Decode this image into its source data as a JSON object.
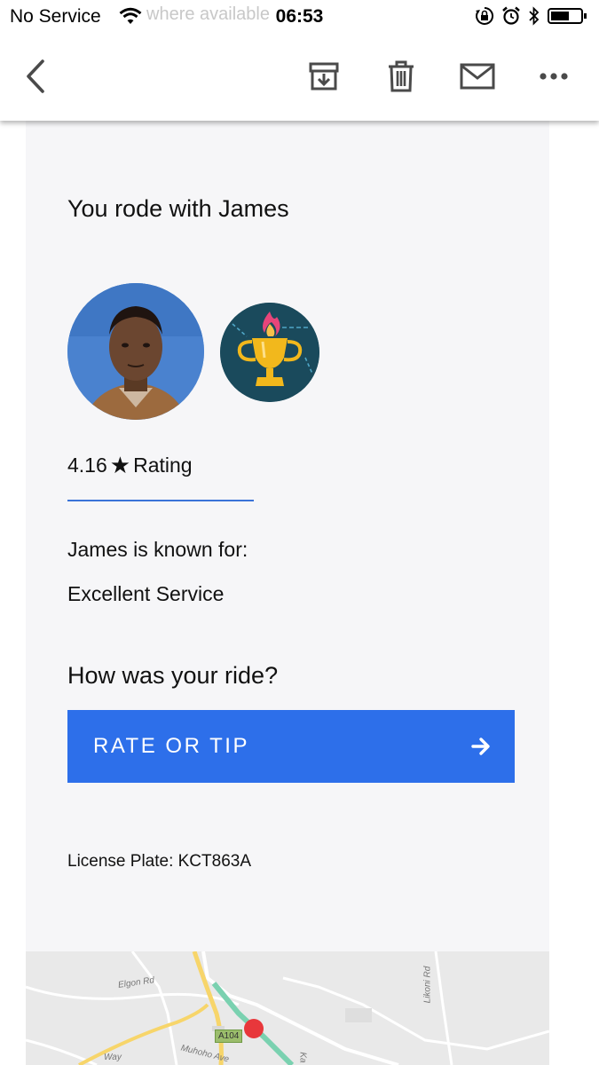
{
  "status_bar": {
    "carrier": "No Service",
    "ghost_text": "where available",
    "time": "06:53",
    "icons": [
      "wifi-icon",
      "orientation-lock-icon",
      "alarm-icon",
      "bluetooth-icon",
      "battery-icon"
    ]
  },
  "toolbar": {
    "icons": [
      "back-icon",
      "archive-icon",
      "trash-icon",
      "mail-icon",
      "more-icon"
    ]
  },
  "email": {
    "title": "You rode with James",
    "rating_value": "4.16",
    "rating_label": "Rating",
    "known_for_label": "James is known for:",
    "known_for_value": "Excellent Service",
    "question": "How was your ride?",
    "cta_label": "RATE OR TIP",
    "license_plate": "License Plate: KCT863A"
  },
  "map": {
    "labels": {
      "elgon": "Elgon Rd",
      "likoni": "Likoni Rd",
      "a104": "A104",
      "muhoho": "Muhoho Ave",
      "way": "Way",
      "ka": "Ka"
    }
  },
  "colors": {
    "accent": "#2d6fea",
    "card_bg": "#f6f6f8",
    "badge_bg": "#1a4a5c",
    "trophy": "#f2b81c",
    "map_pin": "#e8373b"
  }
}
